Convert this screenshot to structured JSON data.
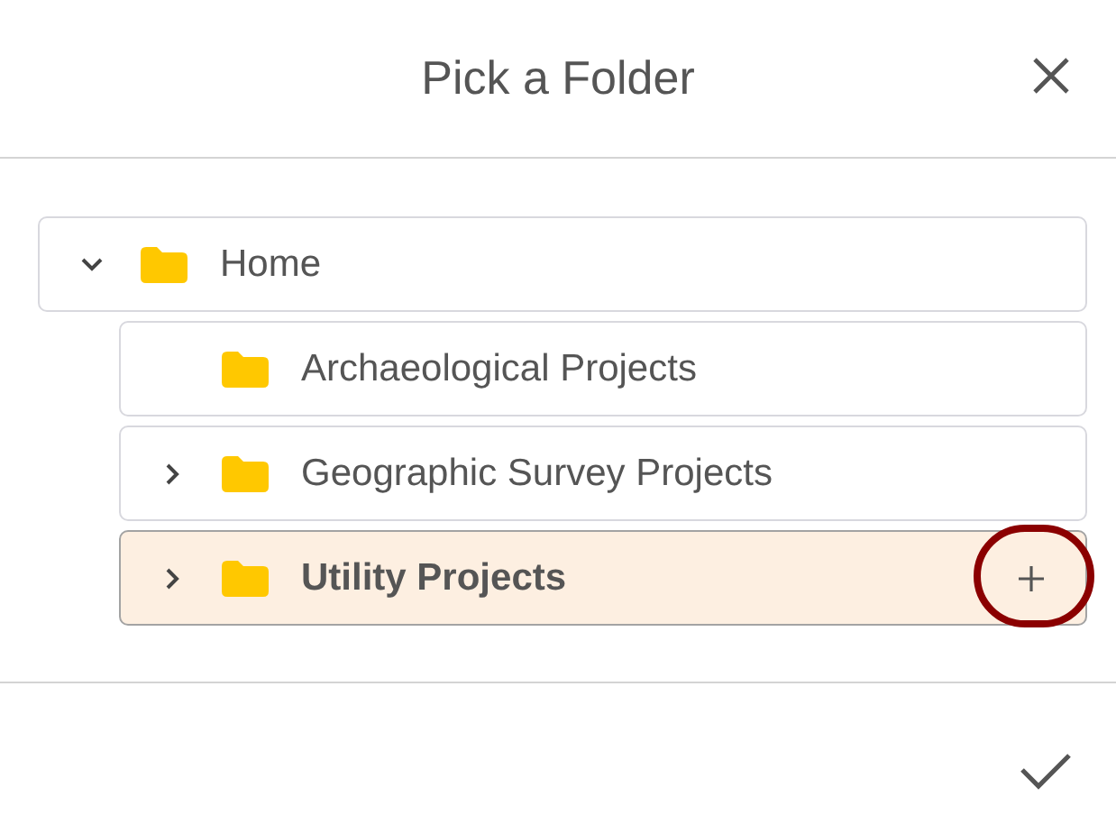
{
  "dialog": {
    "title": "Pick a Folder"
  },
  "tree": [
    {
      "label": "Home",
      "expandable": true,
      "expanded": true,
      "selected": false,
      "children": [
        {
          "label": "Archaeological Projects",
          "expandable": false,
          "selected": false
        },
        {
          "label": "Geographic Survey Projects",
          "expandable": true,
          "expanded": false,
          "selected": false
        },
        {
          "label": "Utility Projects",
          "expandable": true,
          "expanded": false,
          "selected": true,
          "add_button": true,
          "highlighted": true
        }
      ]
    }
  ]
}
